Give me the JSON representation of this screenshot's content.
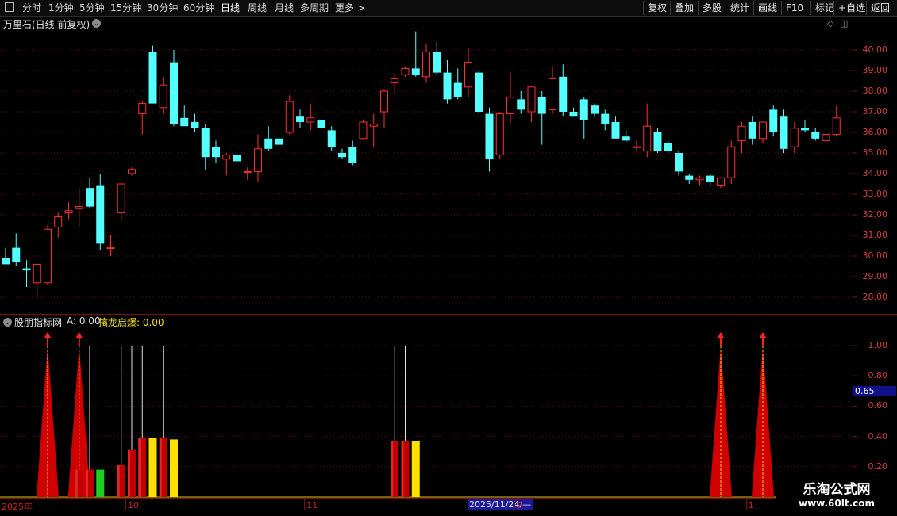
{
  "toolbar": {
    "items": [
      {
        "label": "分时",
        "active": false
      },
      {
        "label": "1分钟",
        "active": false
      },
      {
        "label": "5分钟",
        "active": false
      },
      {
        "label": "15分钟",
        "active": false
      },
      {
        "label": "30分钟",
        "active": false
      },
      {
        "label": "60分钟",
        "active": false
      },
      {
        "label": "日线",
        "active": true
      },
      {
        "label": "周线",
        "active": false
      },
      {
        "label": "月线",
        "active": false
      },
      {
        "label": "多周期",
        "active": false
      },
      {
        "label": "更多 >",
        "active": false
      }
    ],
    "right_items": [
      "复权",
      "叠加",
      "多股",
      "统计",
      "画线",
      "F10",
      "+自选",
      "返回"
    ]
  },
  "main_chart": {
    "title": "万里石(日线 前复权)",
    "price_axis": [
      "40.00",
      "39.00",
      "38.00",
      "37.00",
      "36.00",
      "35.00",
      "34.00",
      "33.00",
      "32.00",
      "31.00",
      "30.00",
      "29.00",
      "28.00"
    ],
    "candles": [
      [
        29.9,
        30.4,
        29.6,
        29.6
      ],
      [
        30.4,
        31.1,
        29.5,
        29.7
      ],
      [
        29.4,
        29.8,
        28.5,
        29.3
      ],
      [
        28.7,
        29.5,
        28.0,
        29.6
      ],
      [
        28.7,
        31.5,
        28.6,
        31.3
      ],
      [
        31.4,
        32.1,
        30.9,
        31.9
      ],
      [
        32.1,
        32.6,
        31.8,
        32.2
      ],
      [
        32.3,
        33.3,
        31.4,
        32.4
      ],
      [
        33.3,
        33.8,
        32.3,
        32.4
      ],
      [
        33.4,
        34.0,
        30.3,
        30.6
      ],
      [
        30.4,
        31.0,
        30.0,
        30.4
      ],
      [
        32.1,
        33.3,
        31.7,
        33.5
      ],
      [
        34.0,
        34.3,
        33.9,
        34.2
      ],
      [
        36.9,
        37.5,
        35.9,
        37.4
      ],
      [
        39.9,
        40.2,
        37.5,
        37.4
      ],
      [
        37.2,
        38.7,
        36.9,
        38.3
      ],
      [
        39.4,
        40.0,
        36.3,
        36.4
      ],
      [
        36.7,
        37.3,
        36.3,
        36.3
      ],
      [
        36.5,
        36.9,
        36.0,
        36.2
      ],
      [
        36.2,
        36.4,
        34.2,
        34.8
      ],
      [
        35.3,
        35.6,
        34.5,
        34.8
      ],
      [
        34.7,
        35.0,
        33.9,
        34.9
      ],
      [
        34.9,
        35.0,
        34.7,
        34.6
      ],
      [
        34.1,
        34.3,
        33.7,
        34.1
      ],
      [
        34.1,
        35.9,
        33.6,
        35.2
      ],
      [
        35.7,
        36.3,
        35.1,
        35.2
      ],
      [
        35.7,
        36.7,
        35.4,
        35.4
      ],
      [
        36.0,
        37.8,
        35.9,
        37.5
      ],
      [
        36.8,
        37.1,
        36.2,
        36.5
      ],
      [
        36.5,
        37.4,
        36.1,
        36.7
      ],
      [
        36.6,
        36.8,
        36.2,
        36.2
      ],
      [
        36.1,
        36.3,
        35.1,
        35.3
      ],
      [
        35.0,
        35.2,
        34.7,
        34.8
      ],
      [
        35.3,
        35.6,
        34.4,
        34.5
      ],
      [
        35.7,
        36.6,
        35.7,
        36.5
      ],
      [
        36.3,
        36.9,
        35.3,
        36.4
      ],
      [
        37.0,
        38.1,
        36.2,
        38.0
      ],
      [
        38.4,
        38.9,
        37.8,
        38.6
      ],
      [
        38.8,
        39.2,
        38.7,
        39.1
      ],
      [
        39.1,
        40.9,
        38.7,
        38.8
      ],
      [
        38.7,
        40.3,
        38.4,
        39.9
      ],
      [
        39.9,
        40.4,
        38.8,
        38.9
      ],
      [
        38.9,
        39.5,
        37.4,
        37.6
      ],
      [
        38.4,
        39.1,
        37.6,
        37.7
      ],
      [
        38.2,
        40.1,
        37.7,
        39.4
      ],
      [
        38.9,
        39.0,
        36.9,
        37.0
      ],
      [
        36.9,
        37.2,
        34.1,
        34.7
      ],
      [
        34.9,
        37.0,
        34.7,
        36.9
      ],
      [
        36.9,
        38.9,
        36.4,
        37.7
      ],
      [
        37.6,
        38.0,
        36.9,
        37.1
      ],
      [
        37.0,
        38.2,
        36.5,
        38.2
      ],
      [
        37.7,
        38.0,
        35.4,
        36.9
      ],
      [
        37.1,
        39.2,
        36.9,
        38.6
      ],
      [
        38.7,
        39.3,
        36.8,
        37.0
      ],
      [
        37.0,
        37.2,
        36.8,
        36.8
      ],
      [
        37.6,
        37.7,
        35.7,
        36.6
      ],
      [
        37.3,
        37.4,
        36.8,
        36.9
      ],
      [
        36.9,
        37.1,
        36.1,
        36.4
      ],
      [
        36.5,
        36.8,
        35.9,
        35.7
      ],
      [
        35.8,
        36.1,
        35.5,
        35.6
      ],
      [
        35.3,
        35.6,
        35.1,
        35.3
      ],
      [
        35.1,
        37.4,
        34.8,
        36.3
      ],
      [
        36.0,
        36.2,
        35.0,
        35.1
      ],
      [
        35.5,
        35.6,
        35.0,
        35.1
      ],
      [
        35.0,
        35.1,
        33.9,
        34.1
      ],
      [
        33.9,
        34.0,
        33.5,
        33.7
      ],
      [
        33.7,
        33.9,
        33.4,
        33.8
      ],
      [
        33.9,
        34.0,
        33.4,
        33.6
      ],
      [
        33.4,
        33.8,
        33.3,
        33.8
      ],
      [
        33.8,
        35.6,
        33.5,
        35.3
      ],
      [
        35.6,
        36.5,
        35.0,
        36.3
      ],
      [
        36.5,
        36.8,
        35.4,
        35.7
      ],
      [
        35.7,
        36.3,
        35.5,
        36.5
      ],
      [
        37.1,
        37.3,
        35.8,
        36.0
      ],
      [
        36.8,
        37.1,
        35.0,
        35.2
      ],
      [
        35.3,
        36.5,
        35.0,
        36.2
      ],
      [
        36.2,
        36.6,
        36.0,
        36.1
      ],
      [
        36.0,
        36.2,
        35.6,
        35.7
      ],
      [
        35.6,
        36.6,
        35.4,
        35.9
      ],
      [
        35.9,
        37.3,
        35.8,
        36.7
      ]
    ]
  },
  "indicator": {
    "name": "股朋指标网",
    "a_label": "A: 0.00",
    "b_label": "擒龙启爆: 0.00",
    "axis": [
      "1.00",
      "0.80",
      "0.60",
      "0.40",
      "0.20"
    ],
    "marker_value": "0.65",
    "arrows": [
      4,
      7,
      68,
      72
    ],
    "bars": [
      {
        "i": 7,
        "v": 0.18,
        "c": "red"
      },
      {
        "i": 8,
        "v": 0.18,
        "c": "red"
      },
      {
        "i": 9,
        "v": 0.18,
        "c": "green"
      },
      {
        "i": 11,
        "v": 0.21,
        "c": "red"
      },
      {
        "i": 12,
        "v": 0.31,
        "c": "red"
      },
      {
        "i": 13,
        "v": 0.39,
        "c": "red"
      },
      {
        "i": 14,
        "v": 0.39,
        "c": "yellow"
      },
      {
        "i": 15,
        "v": 0.39,
        "c": "red"
      },
      {
        "i": 16,
        "v": 0.38,
        "c": "yellow"
      },
      {
        "i": 37,
        "v": 0.37,
        "c": "red"
      },
      {
        "i": 38,
        "v": 0.37,
        "c": "red"
      },
      {
        "i": 39,
        "v": 0.37,
        "c": "yellow"
      }
    ],
    "lines": [
      8,
      11,
      12,
      13,
      15,
      37,
      38
    ]
  },
  "date_axis": {
    "labels": [
      {
        "text": "2025年",
        "i": 0
      },
      {
        "text": "10",
        "i": 12
      },
      {
        "text": "11",
        "i": 29
      },
      {
        "text": "2",
        "i": 49
      },
      {
        "text": "1",
        "i": 71
      }
    ],
    "cursor": "2025/11/24/—"
  },
  "watermark": {
    "title": "乐淘公式网",
    "url": "www.60lt.com"
  },
  "colors": {
    "up": "#ff3030",
    "down": "#54ffff",
    "axis": "#7a1010",
    "bg": "#000000"
  }
}
